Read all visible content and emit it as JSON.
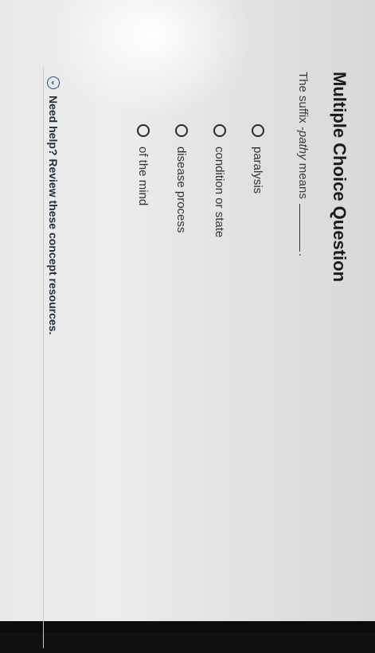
{
  "question": {
    "title": "Multiple Choice Question",
    "stem_prefix": "The suffix ",
    "stem_term": "-pathy",
    "stem_suffix": " means",
    "stem_end": "."
  },
  "options": [
    {
      "label": "paralysis"
    },
    {
      "label": "condition or state"
    },
    {
      "label": "disease process"
    },
    {
      "label": "of the mind"
    }
  ],
  "help": {
    "label": "Need help? Review these concept resources."
  }
}
